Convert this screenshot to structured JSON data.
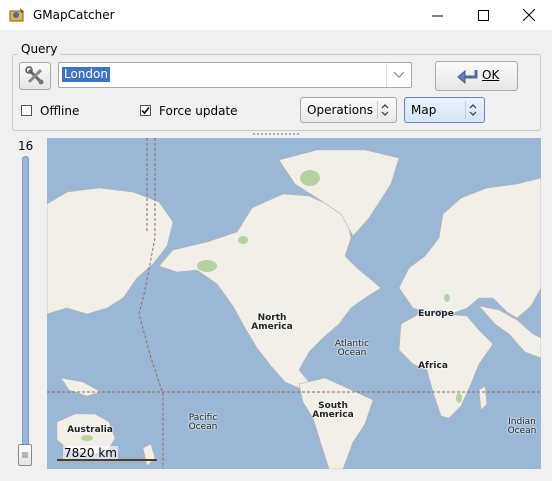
{
  "window": {
    "title": "GMapCatcher"
  },
  "query": {
    "label": "Query",
    "search_value": "London",
    "ok_label": "OK"
  },
  "options": {
    "offline_label": "Offline",
    "offline_checked": false,
    "force_update_label": "Force update",
    "force_update_checked": true,
    "operations_label": "Operations",
    "map_type_label": "Map"
  },
  "zoom": {
    "level": "16"
  },
  "map": {
    "labels": {
      "north_america": "North America",
      "atlantic": "Atlantic Ocean",
      "europe": "Europe",
      "africa": "Africa",
      "pacific": "Pacific Ocean",
      "south_america": "South America",
      "australia": "Australia",
      "indian": "Indian Ocean"
    },
    "scale": "7820 km"
  },
  "colors": {
    "water": "#9ab8d6",
    "land": "#f2efe9",
    "selection": "#3d74c7"
  }
}
